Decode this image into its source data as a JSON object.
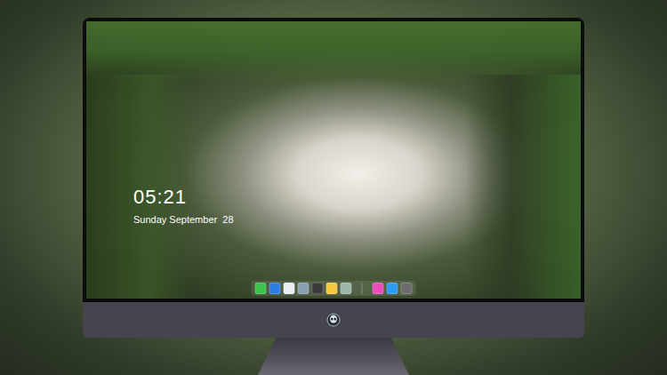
{
  "lock_screen": {
    "time": "05:21",
    "date": "Sunday September  28"
  },
  "dock": {
    "apps": [
      {
        "color": "#3ec34a"
      },
      {
        "color": "#2f7de1"
      },
      {
        "color": "#e9eef3"
      },
      {
        "color": "#8aa0b0"
      },
      {
        "color": "#3a3a3a"
      },
      {
        "color": "#f5c842"
      },
      {
        "color": "#9bb7a8"
      }
    ],
    "others": [
      {
        "color": "#e84dbb"
      },
      {
        "color": "#2d9bf0"
      },
      {
        "color": "#6b6b6b"
      }
    ]
  }
}
